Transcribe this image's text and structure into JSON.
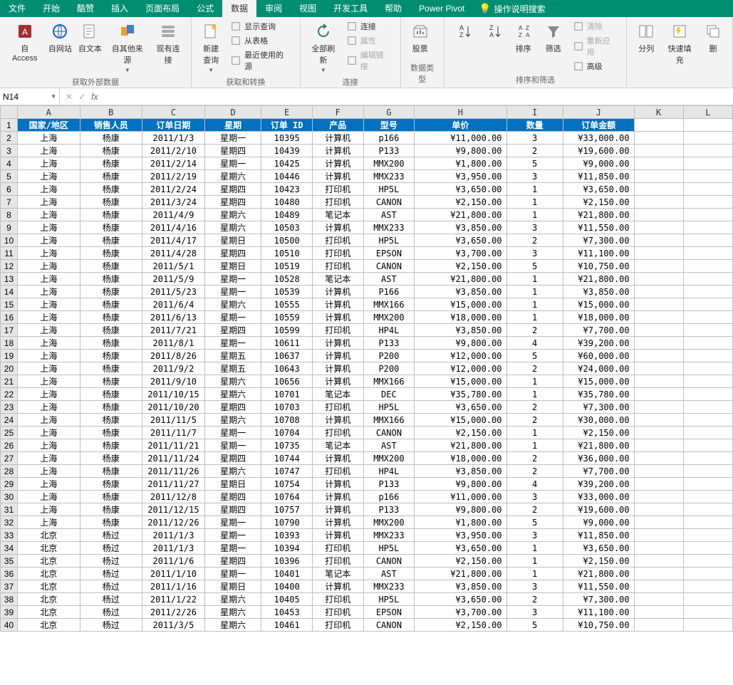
{
  "menubar": {
    "tabs": [
      "文件",
      "开始",
      "酷赞",
      "插入",
      "页面布局",
      "公式",
      "数据",
      "审阅",
      "视图",
      "开发工具",
      "帮助",
      "Power Pivot"
    ],
    "active_index": 6,
    "tell_me": "操作说明搜索"
  },
  "ribbon": {
    "groups": [
      {
        "label": "获取外部数据",
        "big_buttons": [
          {
            "name": "from-access",
            "label": "自 Access"
          },
          {
            "name": "from-web",
            "label": "自网站"
          },
          {
            "name": "from-text",
            "label": "自文本"
          },
          {
            "name": "from-other",
            "label": "自其他来源"
          },
          {
            "name": "existing-conn",
            "label": "现有连接"
          }
        ]
      },
      {
        "label": "获取和转换",
        "big_buttons": [
          {
            "name": "new-query",
            "label": "新建\n查询"
          }
        ],
        "sub": [
          {
            "name": "show-query",
            "label": "显示查询"
          },
          {
            "name": "from-table",
            "label": "从表格"
          },
          {
            "name": "recent-sources",
            "label": "最近使用的源"
          }
        ]
      },
      {
        "label": "连接",
        "big_buttons": [
          {
            "name": "refresh-all",
            "label": "全部刷新"
          }
        ],
        "sub": [
          {
            "name": "connections",
            "label": "连接"
          },
          {
            "name": "properties",
            "label": "属性",
            "disabled": true
          },
          {
            "name": "edit-links",
            "label": "编辑链接",
            "disabled": true
          }
        ]
      },
      {
        "label": "数据类型",
        "big_buttons": [
          {
            "name": "stocks",
            "label": "股票"
          }
        ]
      },
      {
        "label": "排序和筛选",
        "big_buttons": [
          {
            "name": "sort-asc",
            "label": ""
          },
          {
            "name": "sort-desc",
            "label": ""
          },
          {
            "name": "sort",
            "label": "排序"
          },
          {
            "name": "filter",
            "label": "筛选"
          }
        ],
        "sub": [
          {
            "name": "clear",
            "label": "清除",
            "disabled": true
          },
          {
            "name": "reapply",
            "label": "重新应用",
            "disabled": true
          },
          {
            "name": "advanced",
            "label": "高级"
          }
        ]
      },
      {
        "label": "",
        "big_buttons": [
          {
            "name": "text-to-cols",
            "label": "分列"
          },
          {
            "name": "flash-fill",
            "label": "快速填充"
          },
          {
            "name": "dedup",
            "label": "删"
          }
        ]
      }
    ]
  },
  "formula_bar": {
    "name_box": "N14",
    "formula": ""
  },
  "sheet": {
    "col_letters": [
      "A",
      "B",
      "C",
      "D",
      "E",
      "F",
      "G",
      "H",
      "I",
      "J",
      "K",
      "L"
    ],
    "headers": [
      "国家/地区",
      "销售人员",
      "订单日期",
      "星期",
      "订单 ID",
      "产品",
      "型号",
      "单价",
      "数量",
      "订单金额"
    ],
    "rows": [
      [
        "上海",
        "杨康",
        "2011/1/3",
        "星期一",
        "10395",
        "计算机",
        "p166",
        "¥11,000.00",
        "3",
        "¥33,000.00"
      ],
      [
        "上海",
        "杨康",
        "2011/2/10",
        "星期四",
        "10439",
        "计算机",
        "P133",
        "¥9,800.00",
        "2",
        "¥19,600.00"
      ],
      [
        "上海",
        "杨康",
        "2011/2/14",
        "星期一",
        "10425",
        "计算机",
        "MMX200",
        "¥1,800.00",
        "5",
        "¥9,000.00"
      ],
      [
        "上海",
        "杨康",
        "2011/2/19",
        "星期六",
        "10446",
        "计算机",
        "MMX233",
        "¥3,950.00",
        "3",
        "¥11,850.00"
      ],
      [
        "上海",
        "杨康",
        "2011/2/24",
        "星期四",
        "10423",
        "打印机",
        "HP5L",
        "¥3,650.00",
        "1",
        "¥3,650.00"
      ],
      [
        "上海",
        "杨康",
        "2011/3/24",
        "星期四",
        "10480",
        "打印机",
        "CANON",
        "¥2,150.00",
        "1",
        "¥2,150.00"
      ],
      [
        "上海",
        "杨康",
        "2011/4/9",
        "星期六",
        "10489",
        "笔记本",
        "AST",
        "¥21,800.00",
        "1",
        "¥21,800.00"
      ],
      [
        "上海",
        "杨康",
        "2011/4/16",
        "星期六",
        "10503",
        "计算机",
        "MMX233",
        "¥3,850.00",
        "3",
        "¥11,550.00"
      ],
      [
        "上海",
        "杨康",
        "2011/4/17",
        "星期日",
        "10500",
        "打印机",
        "HP5L",
        "¥3,650.00",
        "2",
        "¥7,300.00"
      ],
      [
        "上海",
        "杨康",
        "2011/4/28",
        "星期四",
        "10510",
        "打印机",
        "EPSON",
        "¥3,700.00",
        "3",
        "¥11,100.00"
      ],
      [
        "上海",
        "杨康",
        "2011/5/1",
        "星期日",
        "10519",
        "打印机",
        "CANON",
        "¥2,150.00",
        "5",
        "¥10,750.00"
      ],
      [
        "上海",
        "杨康",
        "2011/5/9",
        "星期一",
        "10528",
        "笔记本",
        "AST",
        "¥21,800.00",
        "1",
        "¥21,800.00"
      ],
      [
        "上海",
        "杨康",
        "2011/5/23",
        "星期一",
        "10539",
        "计算机",
        "P166",
        "¥3,850.00",
        "1",
        "¥3,850.00"
      ],
      [
        "上海",
        "杨康",
        "2011/6/4",
        "星期六",
        "10555",
        "计算机",
        "MMX166",
        "¥15,000.00",
        "1",
        "¥15,000.00"
      ],
      [
        "上海",
        "杨康",
        "2011/6/13",
        "星期一",
        "10559",
        "计算机",
        "MMX200",
        "¥18,000.00",
        "1",
        "¥18,000.00"
      ],
      [
        "上海",
        "杨康",
        "2011/7/21",
        "星期四",
        "10599",
        "打印机",
        "HP4L",
        "¥3,850.00",
        "2",
        "¥7,700.00"
      ],
      [
        "上海",
        "杨康",
        "2011/8/1",
        "星期一",
        "10611",
        "计算机",
        "P133",
        "¥9,800.00",
        "4",
        "¥39,200.00"
      ],
      [
        "上海",
        "杨康",
        "2011/8/26",
        "星期五",
        "10637",
        "计算机",
        "P200",
        "¥12,000.00",
        "5",
        "¥60,000.00"
      ],
      [
        "上海",
        "杨康",
        "2011/9/2",
        "星期五",
        "10643",
        "计算机",
        "P200",
        "¥12,000.00",
        "2",
        "¥24,000.00"
      ],
      [
        "上海",
        "杨康",
        "2011/9/10",
        "星期六",
        "10656",
        "计算机",
        "MMX166",
        "¥15,000.00",
        "1",
        "¥15,000.00"
      ],
      [
        "上海",
        "杨康",
        "2011/10/15",
        "星期六",
        "10701",
        "笔记本",
        "DEC",
        "¥35,780.00",
        "1",
        "¥35,780.00"
      ],
      [
        "上海",
        "杨康",
        "2011/10/20",
        "星期四",
        "10703",
        "打印机",
        "HP5L",
        "¥3,650.00",
        "2",
        "¥7,300.00"
      ],
      [
        "上海",
        "杨康",
        "2011/11/5",
        "星期六",
        "10708",
        "计算机",
        "MMX166",
        "¥15,000.00",
        "2",
        "¥30,000.00"
      ],
      [
        "上海",
        "杨康",
        "2011/11/7",
        "星期一",
        "10704",
        "打印机",
        "CANON",
        "¥2,150.00",
        "1",
        "¥2,150.00"
      ],
      [
        "上海",
        "杨康",
        "2011/11/21",
        "星期一",
        "10735",
        "笔记本",
        "AST",
        "¥21,800.00",
        "1",
        "¥21,800.00"
      ],
      [
        "上海",
        "杨康",
        "2011/11/24",
        "星期四",
        "10744",
        "计算机",
        "MMX200",
        "¥18,000.00",
        "2",
        "¥36,000.00"
      ],
      [
        "上海",
        "杨康",
        "2011/11/26",
        "星期六",
        "10747",
        "打印机",
        "HP4L",
        "¥3,850.00",
        "2",
        "¥7,700.00"
      ],
      [
        "上海",
        "杨康",
        "2011/11/27",
        "星期日",
        "10754",
        "计算机",
        "P133",
        "¥9,800.00",
        "4",
        "¥39,200.00"
      ],
      [
        "上海",
        "杨康",
        "2011/12/8",
        "星期四",
        "10764",
        "计算机",
        "p166",
        "¥11,000.00",
        "3",
        "¥33,000.00"
      ],
      [
        "上海",
        "杨康",
        "2011/12/15",
        "星期四",
        "10757",
        "计算机",
        "P133",
        "¥9,800.00",
        "2",
        "¥19,600.00"
      ],
      [
        "上海",
        "杨康",
        "2011/12/26",
        "星期一",
        "10790",
        "计算机",
        "MMX200",
        "¥1,800.00",
        "5",
        "¥9,000.00"
      ],
      [
        "北京",
        "杨过",
        "2011/1/3",
        "星期一",
        "10393",
        "计算机",
        "MMX233",
        "¥3,950.00",
        "3",
        "¥11,850.00"
      ],
      [
        "北京",
        "杨过",
        "2011/1/3",
        "星期一",
        "10394",
        "打印机",
        "HP5L",
        "¥3,650.00",
        "1",
        "¥3,650.00"
      ],
      [
        "北京",
        "杨过",
        "2011/1/6",
        "星期四",
        "10396",
        "打印机",
        "CANON",
        "¥2,150.00",
        "1",
        "¥2,150.00"
      ],
      [
        "北京",
        "杨过",
        "2011/1/10",
        "星期一",
        "10401",
        "笔记本",
        "AST",
        "¥21,800.00",
        "1",
        "¥21,800.00"
      ],
      [
        "北京",
        "杨过",
        "2011/1/16",
        "星期日",
        "10400",
        "计算机",
        "MMX233",
        "¥3,850.00",
        "3",
        "¥11,550.00"
      ],
      [
        "北京",
        "杨过",
        "2011/1/22",
        "星期六",
        "10405",
        "打印机",
        "HP5L",
        "¥3,650.00",
        "2",
        "¥7,300.00"
      ],
      [
        "北京",
        "杨过",
        "2011/2/26",
        "星期六",
        "10453",
        "打印机",
        "EPSON",
        "¥3,700.00",
        "3",
        "¥11,100.00"
      ],
      [
        "北京",
        "杨过",
        "2011/3/5",
        "星期六",
        "10461",
        "打印机",
        "CANON",
        "¥2,150.00",
        "5",
        "¥10,750.00"
      ]
    ]
  }
}
